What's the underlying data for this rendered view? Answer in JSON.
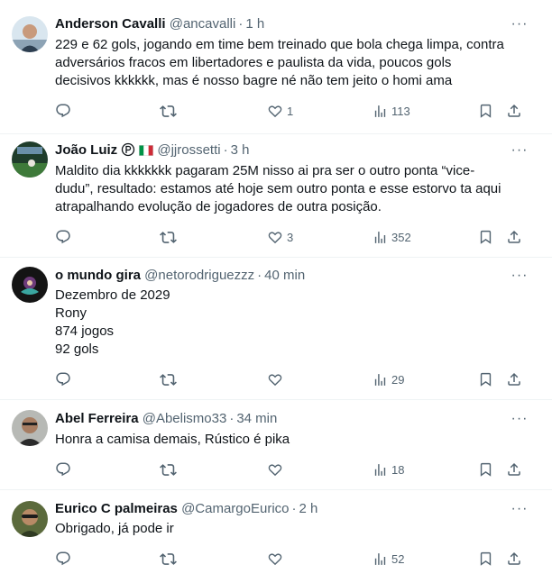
{
  "tweets": [
    {
      "name": "Anderson Cavalli",
      "handle": "@ancavalli",
      "time": "1 h",
      "lines": [
        "229 e 62 gols, jogando em time bem treinado que bola chega limpa, contra",
        "adversários fracos em libertadores e paulista da vida, poucos gols",
        "decisivos kkkkkk, mas é nosso bagre né não tem jeito o homi ama"
      ],
      "likes": "1",
      "views": "113"
    },
    {
      "name": "João Luiz",
      "handle": "@jjrossetti",
      "time": "3 h",
      "lines": [
        "Maldito dia kkkkkkk pagaram 25M nisso ai pra ser o outro ponta “vice-",
        "dudu”, resultado: estamos até hoje sem outro ponta e esse estorvo ta aqui",
        "atrapalhando evolução de jogadores de outra posição."
      ],
      "likes": "3",
      "views": "352"
    },
    {
      "name": "o mundo gira",
      "handle": "@netorodriguezzz",
      "time": "40 min",
      "lines": [
        "Dezembro de 2029",
        "Rony",
        "874 jogos",
        "92 gols"
      ],
      "likes": "",
      "views": "29"
    },
    {
      "name": "Abel Ferreira",
      "handle": "@Abelismo33",
      "time": "34 min",
      "lines": [
        "Honra a camisa demais, Rústico é pika"
      ],
      "likes": "",
      "views": "18"
    },
    {
      "name": "Eurico C palmeiras",
      "handle": "@CamargoEurico",
      "time": "2 h",
      "lines": [
        "Obrigado, já pode ir"
      ],
      "likes": "",
      "views": "52"
    }
  ],
  "dot": "·",
  "more": "···",
  "colors": {
    "text": "#0f1419",
    "muted": "#536471",
    "divider": "#eff3f4"
  },
  "icons": [
    "reply-icon",
    "retweet-icon",
    "like-icon",
    "views-icon",
    "bookmark-icon",
    "share-icon",
    "more-icon",
    "verified-icon",
    "italy-flag-icon"
  ]
}
